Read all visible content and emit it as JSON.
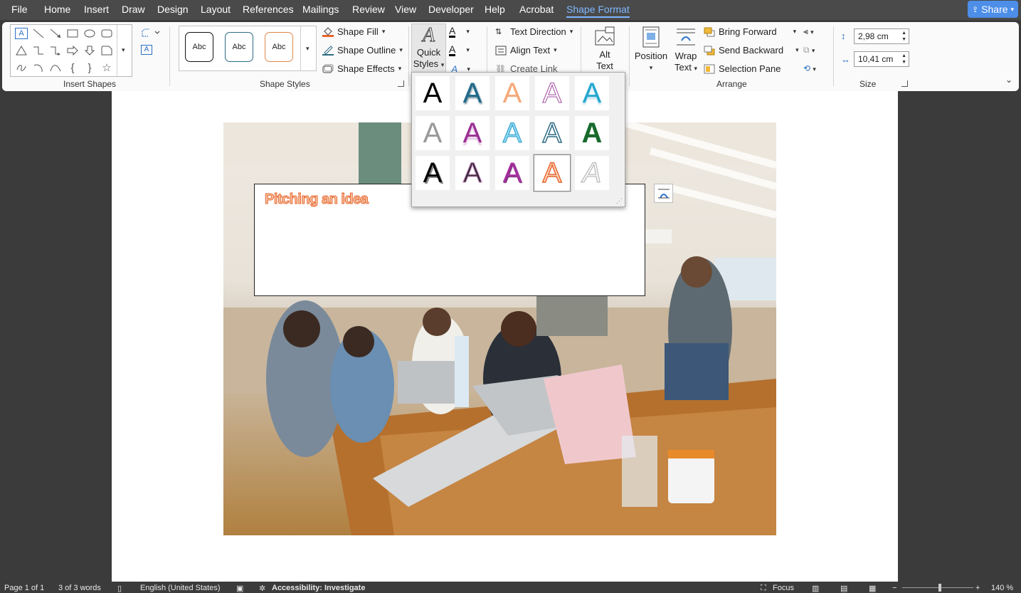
{
  "menu": {
    "file": "File",
    "home": "Home",
    "insert": "Insert",
    "draw": "Draw",
    "design": "Design",
    "layout": "Layout",
    "references": "References",
    "mailings": "Mailings",
    "review": "Review",
    "view": "View",
    "developer": "Developer",
    "help": "Help",
    "acrobat": "Acrobat",
    "shape_format": "Shape Format",
    "share": "Share"
  },
  "ribbon": {
    "insert_shapes": {
      "label": "Insert Shapes"
    },
    "shape_styles": {
      "label": "Shape Styles",
      "swatch": "Abc",
      "fill": "Shape Fill",
      "outline": "Shape Outline",
      "effects": "Shape Effects"
    },
    "wordart": {
      "quick_styles": "Quick",
      "quick_styles2": "Styles",
      "glyph": "A"
    },
    "text": {
      "direction": "Text Direction",
      "align": "Align Text",
      "link": "Create Link"
    },
    "alt_text": {
      "l1": "Alt",
      "l2": "Text"
    },
    "arrange": {
      "label": "Arrange",
      "position": "Position",
      "wrap1": "Wrap",
      "wrap2": "Text",
      "bring_forward": "Bring Forward",
      "send_backward": "Send Backward",
      "selection_pane": "Selection Pane"
    },
    "size": {
      "label": "Size",
      "height": "2,98 cm",
      "width": "10,41 cm"
    }
  },
  "document": {
    "textbox_text": "Pitching an idea"
  },
  "gallery": {
    "glyph": "A"
  },
  "status": {
    "page": "Page 1 of 1",
    "words": "3 of 3 words",
    "language": "English (United States)",
    "accessibility": "Accessibility: Investigate",
    "focus": "Focus",
    "zoom": "140 %"
  },
  "colors": {
    "accent": "#7fb7ff",
    "share_bg": "#4c8ee8",
    "wordart_orange": "#e8642c"
  }
}
